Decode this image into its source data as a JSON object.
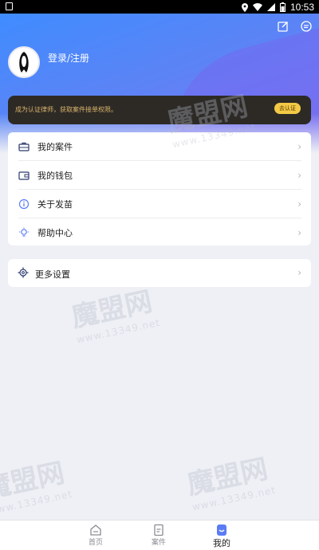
{
  "status_bar": {
    "time": "10:53"
  },
  "header": {
    "login_label": "登录/注册"
  },
  "banner": {
    "text": "成为认证律师，获取案件接单权限。",
    "button_label": "去认证"
  },
  "menu": {
    "items": [
      {
        "label": "我的案件",
        "icon": "briefcase-icon"
      },
      {
        "label": "我的钱包",
        "icon": "wallet-icon"
      },
      {
        "label": "关于发苗",
        "icon": "info-icon"
      },
      {
        "label": "帮助中心",
        "icon": "lightbulb-icon"
      }
    ]
  },
  "settings": {
    "label": "更多设置",
    "icon": "gear-icon"
  },
  "tabs": [
    {
      "label": "首页",
      "icon": "home-icon",
      "active": false
    },
    {
      "label": "案件",
      "icon": "document-icon",
      "active": false
    },
    {
      "label": "我的",
      "icon": "user-icon",
      "active": true
    }
  ],
  "watermark": {
    "logo_text": "魔盟网",
    "site": "www.13349.net"
  },
  "colors": {
    "accent": "#5a7cf5",
    "banner_bg": "#2d2a26",
    "banner_btn": "#f3c946"
  }
}
